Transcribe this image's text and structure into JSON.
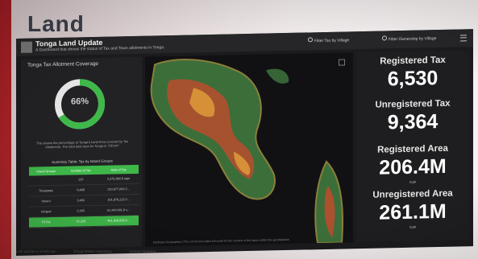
{
  "slide": {
    "title": "Land"
  },
  "dashboard": {
    "title": "Tonga Land Update",
    "subtitle": "A Dashboard that shows the status of Tax and Town allotments in Tonga.",
    "filters": [
      "Filter Tax by Village",
      "Filter Ownership by Village"
    ]
  },
  "coverage": {
    "title": "Tonga Tax Allotment Coverage",
    "percent_label": "66%",
    "percent_value": 0.66,
    "description": "This shows the percentage of Tonga's Land Area covered by Tax Allotments. The total land area for Tonga is 736 km²",
    "accent": "#3fb84a"
  },
  "summary_table": {
    "title": "Summary Table: Tax by Island Groups",
    "headers": [
      "Island Groups",
      "Number of Tax",
      "Area of Tax"
    ],
    "rows": [
      [
        "",
        "133",
        "3,375,990.8 sqm"
      ],
      [
        "Tongatapu",
        "6,498",
        "210,677,063.2..."
      ],
      [
        "Vava'u",
        "3,460",
        "101,876,213.3..."
      ],
      [
        "Ha'apai",
        "3,305",
        "61,340,091.8 s..."
      ]
    ],
    "total": [
      "TOTAL",
      "14,220",
      "451,916,026.4..."
    ]
  },
  "kpis": [
    {
      "label": "Registered Tax",
      "value": "6,530",
      "unit": ""
    },
    {
      "label": "Unregistered Tax",
      "value": "9,364",
      "unit": ""
    },
    {
      "label": "Registered Area",
      "value": "206.4M",
      "unit": "SqM"
    },
    {
      "label": "Unregistered Area",
      "value": "261.1M",
      "unit": "SqM"
    }
  ],
  "map": {
    "caption": "Earthstar Geographics | The LIS Section takes full credit for the creation of the layers within this geodatabase"
  },
  "tabs": [
    "Last update a month ago",
    "Tonga Master Summary",
    "Update Progress"
  ]
}
